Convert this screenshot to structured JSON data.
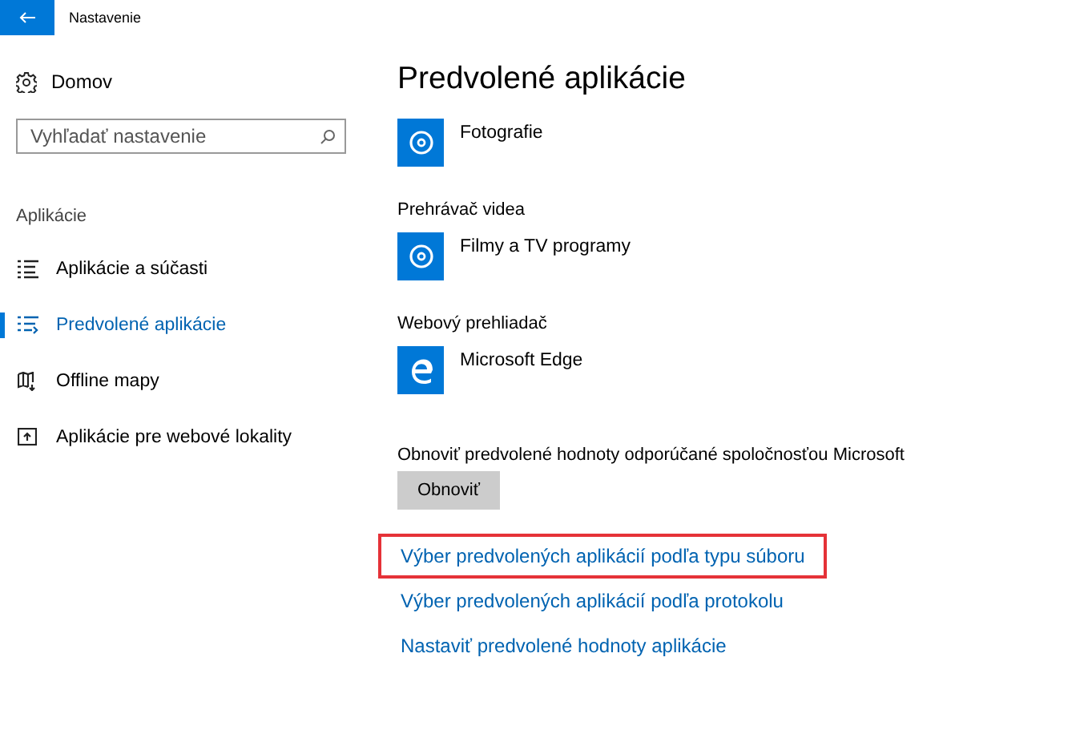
{
  "window": {
    "title": "Nastavenie"
  },
  "sidebar": {
    "home": "Domov",
    "search": {
      "placeholder": "Vyhľadať nastavenie"
    },
    "section": "Aplikácie",
    "items": [
      {
        "label": "Aplikácie a súčasti",
        "kind": "list",
        "selected": false
      },
      {
        "label": "Predvolené aplikácie",
        "kind": "defaults",
        "selected": true
      },
      {
        "label": "Offline mapy",
        "kind": "map",
        "selected": false
      },
      {
        "label": "Aplikácie pre webové lokality",
        "kind": "web",
        "selected": false
      }
    ]
  },
  "content": {
    "title": "Predvolené aplikácie",
    "apps": [
      {
        "name": "Fotografie",
        "kind": "disc"
      },
      {
        "category": "Prehrávač videa",
        "name": "Filmy a TV programy",
        "kind": "disc"
      },
      {
        "category": "Webový prehliadač",
        "name": "Microsoft Edge",
        "kind": "edge"
      }
    ],
    "reset_text": "Obnoviť predvolené hodnoty odporúčané spoločnosťou Microsoft",
    "reset_button": "Obnoviť",
    "links": [
      {
        "label": "Výber predvolených aplikácií podľa typu súboru",
        "highlighted": true
      },
      {
        "label": "Výber predvolených aplikácií podľa protokolu",
        "highlighted": false
      },
      {
        "label": "Nastaviť predvolené hodnoty aplikácie",
        "highlighted": false
      }
    ]
  }
}
